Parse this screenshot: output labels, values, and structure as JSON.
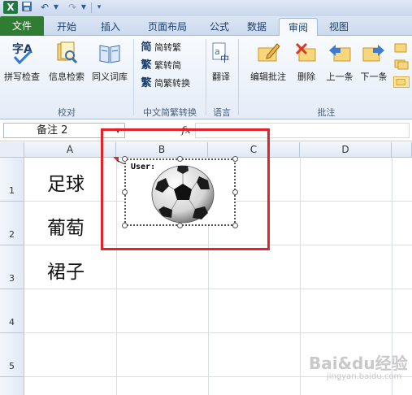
{
  "quick_access": {
    "app_logo": "X",
    "icons": [
      "excel-logo-icon",
      "save-icon",
      "undo-icon",
      "redo-icon",
      "customize-icon"
    ]
  },
  "tabs": {
    "file": "文件",
    "home": "开始",
    "insert": "插入",
    "page_layout": "页面布局",
    "formulas": "公式",
    "data": "数据",
    "review": "审阅",
    "view": "视图"
  },
  "ribbon": {
    "proofing": {
      "label": "校对",
      "spelling": "拼写检查",
      "research": "信息检索",
      "thesaurus": "同义词库"
    },
    "chinese_conversion": {
      "label": "中文简繁转换",
      "to_traditional": "简转繁",
      "to_simplified": "繁转简",
      "conversion": "简繁转换",
      "icon_glyphs": [
        "简",
        "繁",
        "繁"
      ]
    },
    "language": {
      "label": "语言",
      "translate": "翻译"
    },
    "comments": {
      "label": "批注",
      "edit_comment": "编辑批注",
      "delete": "删除",
      "previous": "上一条",
      "next": "下一条"
    }
  },
  "formula_bar": {
    "name_box": "备注 2",
    "fx": "fx",
    "formula": ""
  },
  "sheet": {
    "columns": [
      "A",
      "B",
      "C",
      "D"
    ],
    "rows": [
      "1",
      "2",
      "3",
      "4",
      "5"
    ],
    "cells": {
      "A1": "足球",
      "A2": "葡萄",
      "A3": "裙子"
    }
  },
  "comment": {
    "author": "User:",
    "image": "soccer-ball-image"
  },
  "colors": {
    "file_tab": "#2e7d32",
    "highlight_box": "#e2232a",
    "ribbon_bg": "#e4ecf7"
  },
  "watermark": {
    "main": "Bai&du经验",
    "sub": "jingyan.baidu.com"
  }
}
